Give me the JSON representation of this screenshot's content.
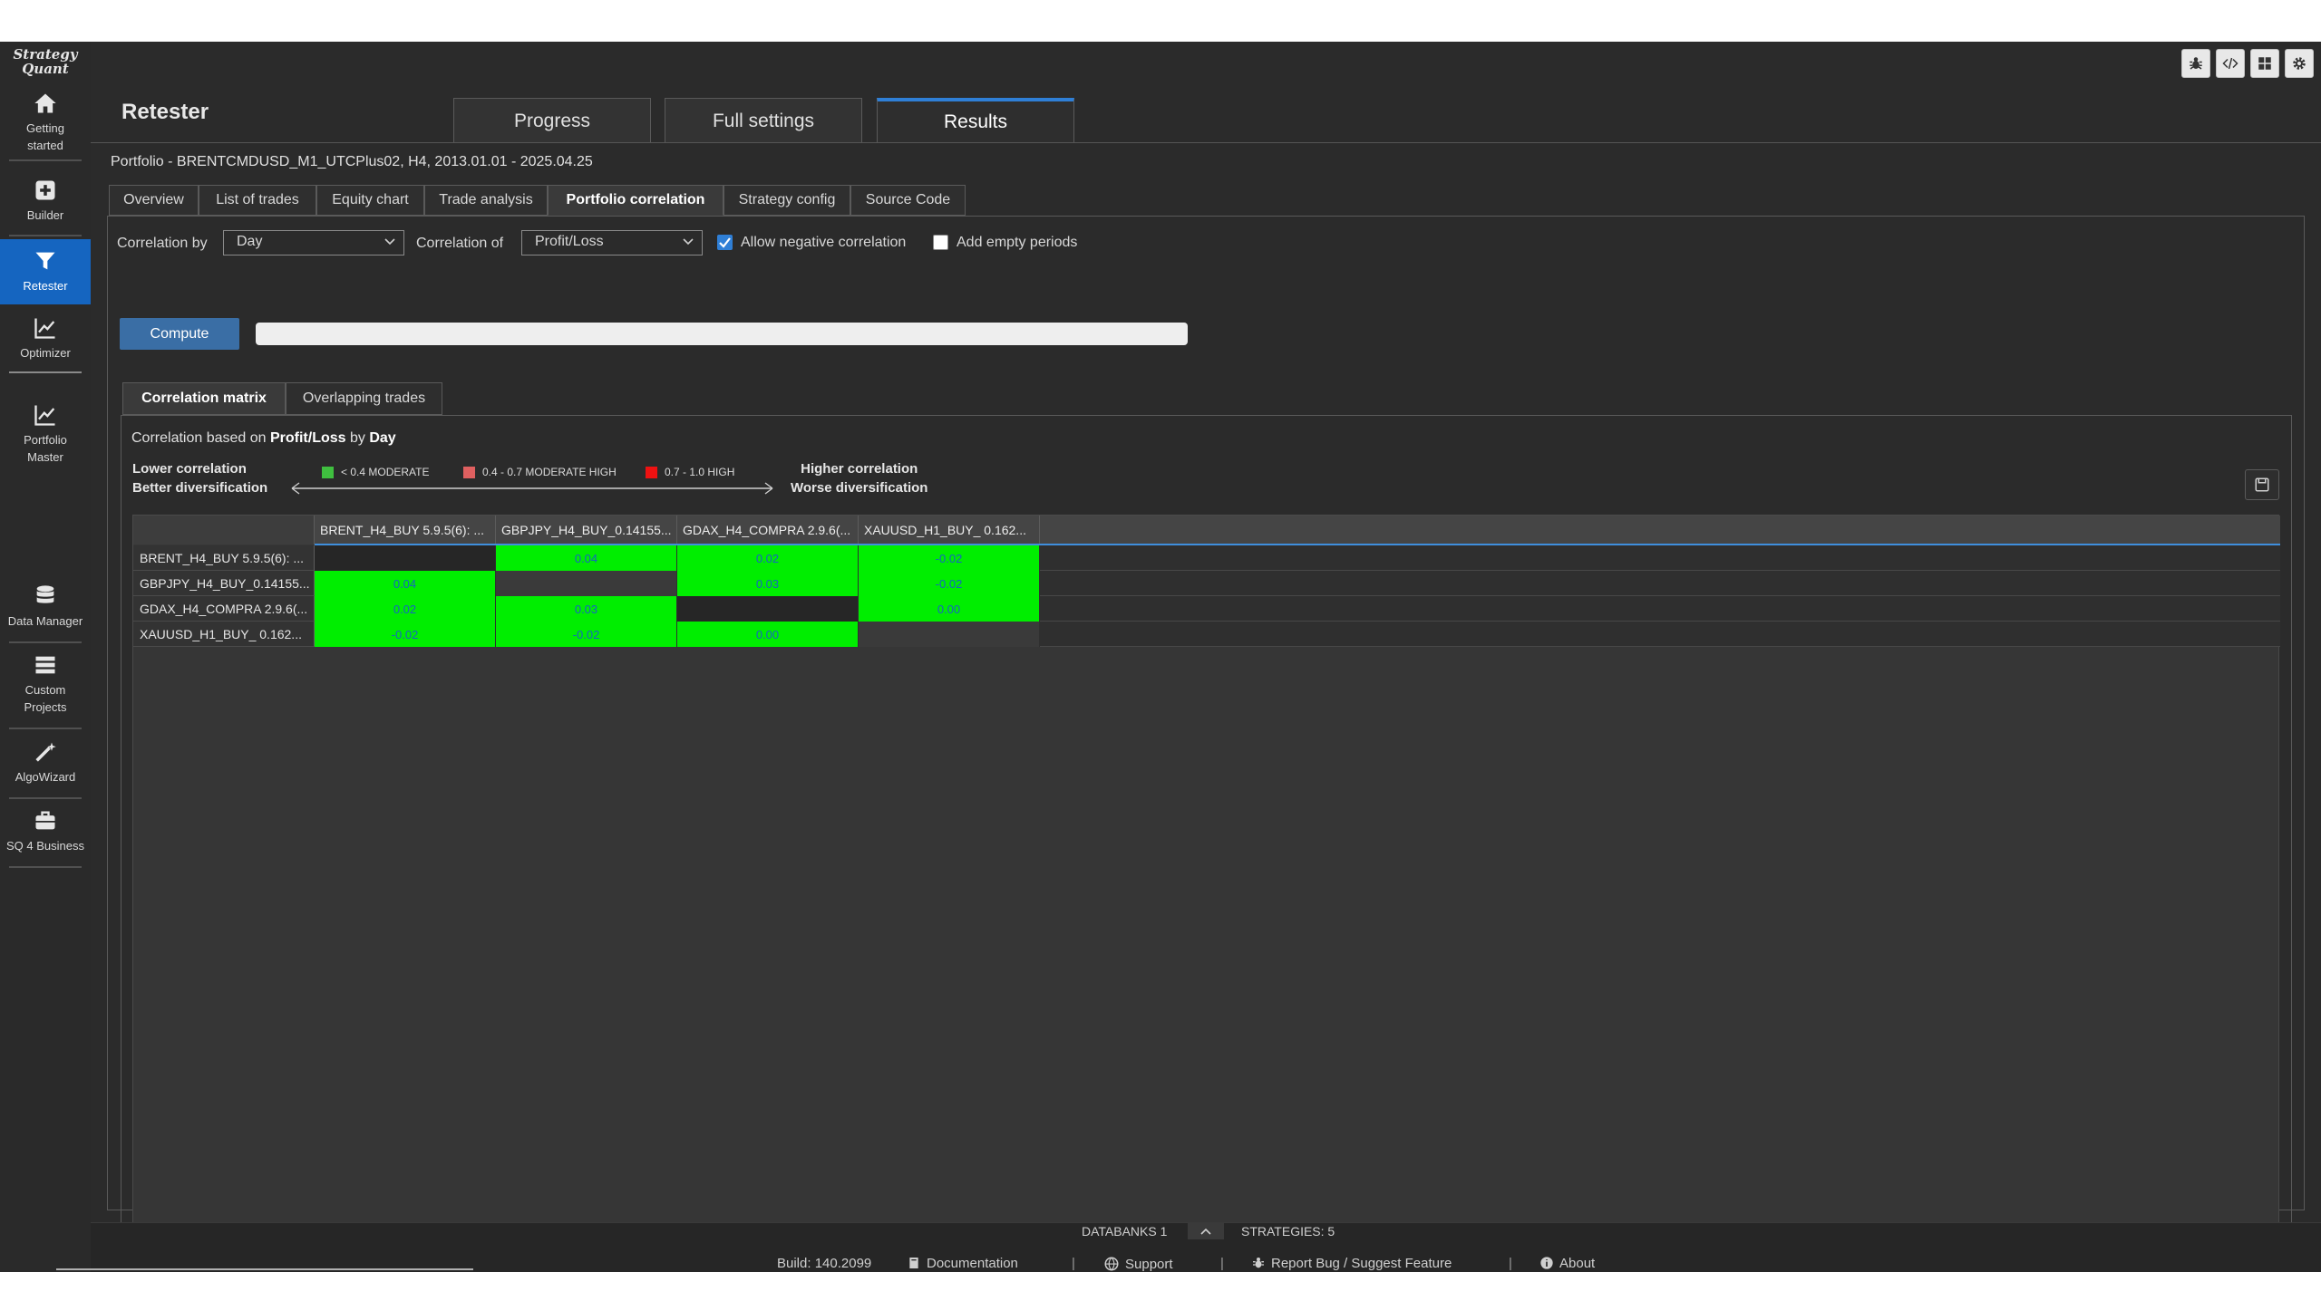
{
  "app": {
    "logo_line1": "Strategy",
    "logo_line2": "Quant"
  },
  "rail": {
    "items": [
      {
        "label": "Getting started",
        "icon": "home-icon"
      },
      {
        "label": "Builder",
        "icon": "plus-icon"
      },
      {
        "label": "Retester",
        "icon": "filter-icon"
      },
      {
        "label": "Optimizer",
        "icon": "chart-icon"
      },
      {
        "label": "Portfolio Master",
        "icon": "chart-icon"
      },
      {
        "label": "Data Manager",
        "icon": "database-icon"
      },
      {
        "label": "Custom Projects",
        "icon": "list-icon"
      },
      {
        "label": "AlgoWizard",
        "icon": "wand-icon"
      },
      {
        "label": "SQ 4 Business",
        "icon": "briefcase-icon"
      }
    ],
    "getting_started_1": "Getting",
    "getting_started_2": "started",
    "builder": "Builder",
    "retester": "Retester",
    "optimizer": "Optimizer",
    "portfolio_1": "Portfolio",
    "portfolio_2": "Master",
    "data_manager": "Data Manager",
    "custom_1": "Custom",
    "custom_2": "Projects",
    "algowizard": "AlgoWizard",
    "sq4business": "SQ 4 Business",
    "active_color": "#1565c0"
  },
  "header": {
    "title": "Retester",
    "tabs": [
      "Progress",
      "Full settings",
      "Results"
    ],
    "active_tab": "Results",
    "portfolio": "Portfolio - BRENTCMDUSD_M1_UTCPlus02, H4, 2013.01.01 - 2025.04.25"
  },
  "subtabs": {
    "overview": "Overview",
    "list_of_trades": "List of trades",
    "equity_chart": "Equity chart",
    "trade_analysis": "Trade analysis",
    "portfolio_correlation": "Portfolio correlation",
    "strategy_config": "Strategy config",
    "source_code": "Source Code",
    "active": "Portfolio correlation"
  },
  "controls": {
    "correlation_by_label": "Correlation by",
    "correlation_by_value": "Day",
    "correlation_of_label": "Correlation of",
    "correlation_of_value": "Profit/Loss",
    "allow_negative_label": "Allow negative correlation",
    "allow_negative_checked": true,
    "add_empty_label": "Add empty periods",
    "add_empty_checked": false,
    "compute_label": "Compute"
  },
  "inner_tabs": {
    "matrix": "Correlation matrix",
    "overlapping": "Overlapping trades",
    "active": "Correlation matrix"
  },
  "matrix_view": {
    "basis_prefix": "Correlation based on ",
    "basis_of": "Profit/Loss",
    "basis_mid": " by ",
    "basis_by": "Day",
    "legend": {
      "lower_1": "Lower correlation",
      "lower_2": "Better diversification",
      "higher_1": "Higher correlation",
      "higher_2": "Worse diversification",
      "moderate": "< 0.4 MODERATE",
      "moderate_high": "0.4 - 0.7 MODERATE HIGH",
      "high": "0.7 - 1.0 HIGH",
      "moderate_color": "#3fbf3f",
      "moderate_high_color": "#e06060",
      "high_color": "#ee1111"
    },
    "columns": [
      "BRENT_H4_BUY 5.9.5(6): ...",
      "GBPJPY_H4_BUY_0.14155...",
      "GDAX_H4_COMPRA 2.9.6(...",
      "XAUUSD_H1_BUY_ 0.162..."
    ],
    "rows": [
      {
        "name": "BRENT_H4_BUY 5.9.5(6): ...",
        "cells": [
          "",
          "0.04",
          "0.02",
          "-0.02"
        ]
      },
      {
        "name": "GBPJPY_H4_BUY_0.14155...",
        "cells": [
          "0.04",
          "",
          "0.03",
          "-0.02"
        ]
      },
      {
        "name": "GDAX_H4_COMPRA 2.9.6(...",
        "cells": [
          "0.02",
          "0.03",
          "",
          "0.00"
        ]
      },
      {
        "name": "XAUUSD_H1_BUY_ 0.162...",
        "cells": [
          "-0.02",
          "-0.02",
          "0.00",
          ""
        ]
      }
    ],
    "cell_color": "#00ee00",
    "value_color": "#1565c0"
  },
  "status": {
    "databanks": "DATABANKS 1",
    "strategies": "STRATEGIES: 5",
    "build": "Build: 140.2099",
    "documentation": "Documentation",
    "support": "Support",
    "report_bug": "Report Bug / Suggest Feature",
    "about": "About",
    "sep": "|"
  }
}
